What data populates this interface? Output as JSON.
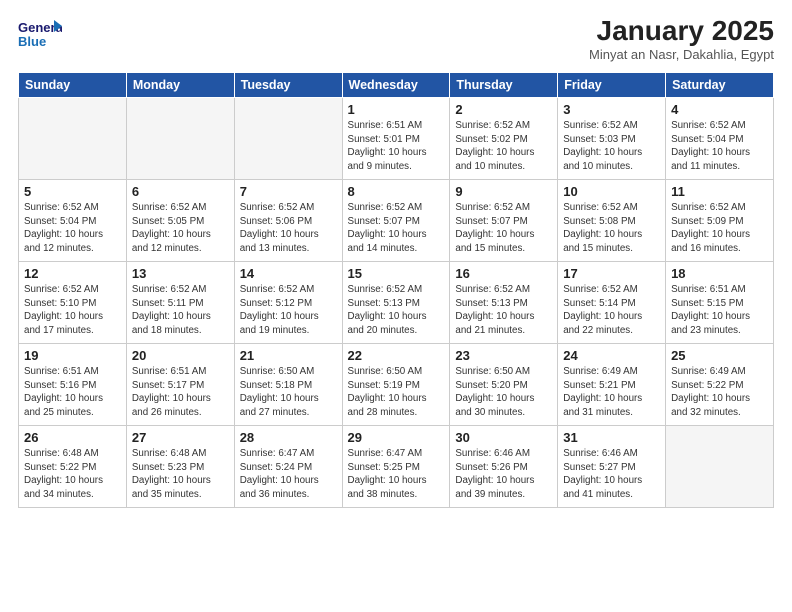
{
  "header": {
    "logo_line1": "General",
    "logo_line2": "Blue",
    "month_title": "January 2025",
    "location": "Minyat an Nasr, Dakahlia, Egypt"
  },
  "days_of_week": [
    "Sunday",
    "Monday",
    "Tuesday",
    "Wednesday",
    "Thursday",
    "Friday",
    "Saturday"
  ],
  "weeks": [
    [
      {
        "day": "",
        "empty": true
      },
      {
        "day": "",
        "empty": true
      },
      {
        "day": "",
        "empty": true
      },
      {
        "day": "1",
        "sunrise": "6:51 AM",
        "sunset": "5:01 PM",
        "daylight": "10 hours and 9 minutes."
      },
      {
        "day": "2",
        "sunrise": "6:52 AM",
        "sunset": "5:02 PM",
        "daylight": "10 hours and 10 minutes."
      },
      {
        "day": "3",
        "sunrise": "6:52 AM",
        "sunset": "5:03 PM",
        "daylight": "10 hours and 10 minutes."
      },
      {
        "day": "4",
        "sunrise": "6:52 AM",
        "sunset": "5:04 PM",
        "daylight": "10 hours and 11 minutes."
      }
    ],
    [
      {
        "day": "5",
        "sunrise": "6:52 AM",
        "sunset": "5:04 PM",
        "daylight": "10 hours and 12 minutes."
      },
      {
        "day": "6",
        "sunrise": "6:52 AM",
        "sunset": "5:05 PM",
        "daylight": "10 hours and 12 minutes."
      },
      {
        "day": "7",
        "sunrise": "6:52 AM",
        "sunset": "5:06 PM",
        "daylight": "10 hours and 13 minutes."
      },
      {
        "day": "8",
        "sunrise": "6:52 AM",
        "sunset": "5:07 PM",
        "daylight": "10 hours and 14 minutes."
      },
      {
        "day": "9",
        "sunrise": "6:52 AM",
        "sunset": "5:07 PM",
        "daylight": "10 hours and 15 minutes."
      },
      {
        "day": "10",
        "sunrise": "6:52 AM",
        "sunset": "5:08 PM",
        "daylight": "10 hours and 15 minutes."
      },
      {
        "day": "11",
        "sunrise": "6:52 AM",
        "sunset": "5:09 PM",
        "daylight": "10 hours and 16 minutes."
      }
    ],
    [
      {
        "day": "12",
        "sunrise": "6:52 AM",
        "sunset": "5:10 PM",
        "daylight": "10 hours and 17 minutes."
      },
      {
        "day": "13",
        "sunrise": "6:52 AM",
        "sunset": "5:11 PM",
        "daylight": "10 hours and 18 minutes."
      },
      {
        "day": "14",
        "sunrise": "6:52 AM",
        "sunset": "5:12 PM",
        "daylight": "10 hours and 19 minutes."
      },
      {
        "day": "15",
        "sunrise": "6:52 AM",
        "sunset": "5:13 PM",
        "daylight": "10 hours and 20 minutes."
      },
      {
        "day": "16",
        "sunrise": "6:52 AM",
        "sunset": "5:13 PM",
        "daylight": "10 hours and 21 minutes."
      },
      {
        "day": "17",
        "sunrise": "6:52 AM",
        "sunset": "5:14 PM",
        "daylight": "10 hours and 22 minutes."
      },
      {
        "day": "18",
        "sunrise": "6:51 AM",
        "sunset": "5:15 PM",
        "daylight": "10 hours and 23 minutes."
      }
    ],
    [
      {
        "day": "19",
        "sunrise": "6:51 AM",
        "sunset": "5:16 PM",
        "daylight": "10 hours and 25 minutes."
      },
      {
        "day": "20",
        "sunrise": "6:51 AM",
        "sunset": "5:17 PM",
        "daylight": "10 hours and 26 minutes."
      },
      {
        "day": "21",
        "sunrise": "6:50 AM",
        "sunset": "5:18 PM",
        "daylight": "10 hours and 27 minutes."
      },
      {
        "day": "22",
        "sunrise": "6:50 AM",
        "sunset": "5:19 PM",
        "daylight": "10 hours and 28 minutes."
      },
      {
        "day": "23",
        "sunrise": "6:50 AM",
        "sunset": "5:20 PM",
        "daylight": "10 hours and 30 minutes."
      },
      {
        "day": "24",
        "sunrise": "6:49 AM",
        "sunset": "5:21 PM",
        "daylight": "10 hours and 31 minutes."
      },
      {
        "day": "25",
        "sunrise": "6:49 AM",
        "sunset": "5:22 PM",
        "daylight": "10 hours and 32 minutes."
      }
    ],
    [
      {
        "day": "26",
        "sunrise": "6:48 AM",
        "sunset": "5:22 PM",
        "daylight": "10 hours and 34 minutes."
      },
      {
        "day": "27",
        "sunrise": "6:48 AM",
        "sunset": "5:23 PM",
        "daylight": "10 hours and 35 minutes."
      },
      {
        "day": "28",
        "sunrise": "6:47 AM",
        "sunset": "5:24 PM",
        "daylight": "10 hours and 36 minutes."
      },
      {
        "day": "29",
        "sunrise": "6:47 AM",
        "sunset": "5:25 PM",
        "daylight": "10 hours and 38 minutes."
      },
      {
        "day": "30",
        "sunrise": "6:46 AM",
        "sunset": "5:26 PM",
        "daylight": "10 hours and 39 minutes."
      },
      {
        "day": "31",
        "sunrise": "6:46 AM",
        "sunset": "5:27 PM",
        "daylight": "10 hours and 41 minutes."
      },
      {
        "day": "",
        "empty": true
      }
    ]
  ]
}
